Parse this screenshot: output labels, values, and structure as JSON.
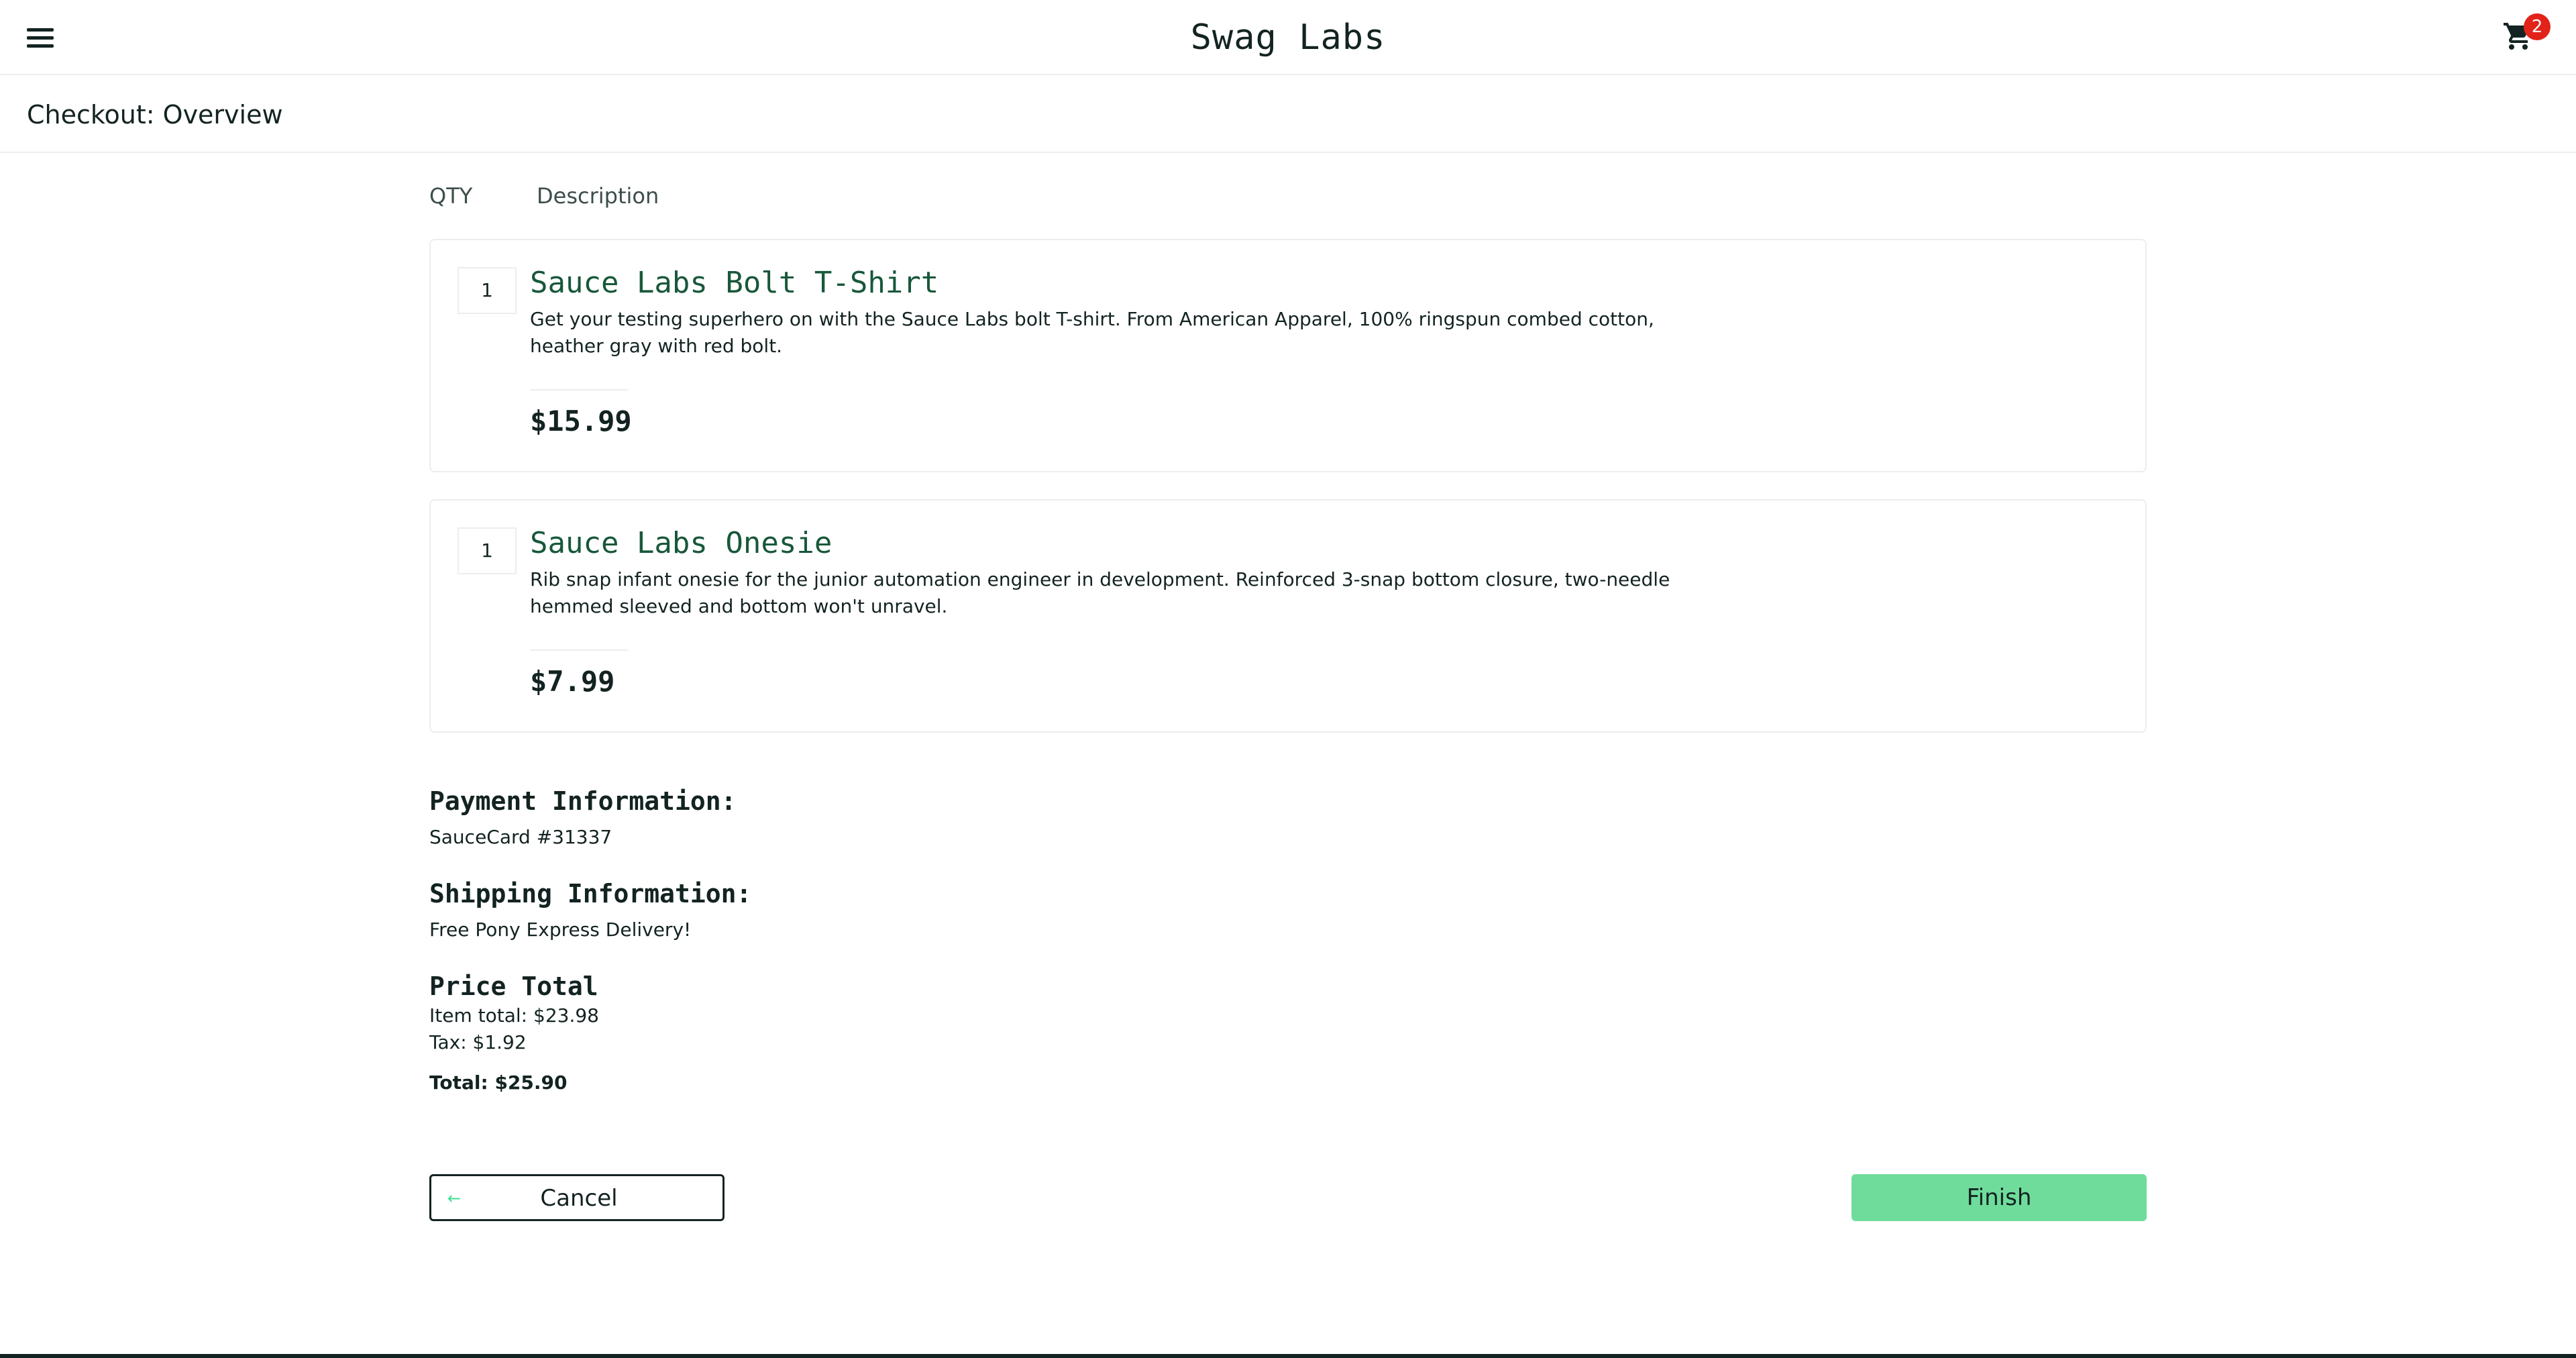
{
  "header": {
    "app_title": "Swag Labs",
    "cart_count": "2"
  },
  "page": {
    "title": "Checkout: Overview"
  },
  "cart_list": {
    "qty_label": "QTY",
    "desc_label": "Description",
    "items": [
      {
        "qty": "1",
        "name": "Sauce Labs Bolt T-Shirt",
        "description": "Get your testing superhero on with the Sauce Labs bolt T-shirt. From American Apparel, 100% ringspun combed cotton, heather gray with red bolt.",
        "price": "$15.99"
      },
      {
        "qty": "1",
        "name": "Sauce Labs Onesie",
        "description": "Rib snap infant onesie for the junior automation engineer in development. Reinforced 3-snap bottom closure, two-needle hemmed sleeved and bottom won't unravel.",
        "price": "$7.99"
      }
    ]
  },
  "summary": {
    "payment_heading": "Payment Information:",
    "payment_value": "SauceCard #31337",
    "shipping_heading": "Shipping Information:",
    "shipping_value": "Free Pony Express Delivery!",
    "price_heading": "Price Total",
    "item_total": "Item total: $23.98",
    "tax": "Tax: $1.92",
    "total": "Total: $25.90"
  },
  "actions": {
    "cancel_label": "Cancel",
    "finish_label": "Finish"
  },
  "icons": {
    "menu": "hamburger-menu-icon",
    "cart": "shopping-cart-icon",
    "back": "arrow-left-icon"
  },
  "colors": {
    "accent": "#3ddc91",
    "finish_button": "#6fdc9c",
    "item_name": "#18583a",
    "badge": "#e2231a",
    "text": "#132322"
  }
}
